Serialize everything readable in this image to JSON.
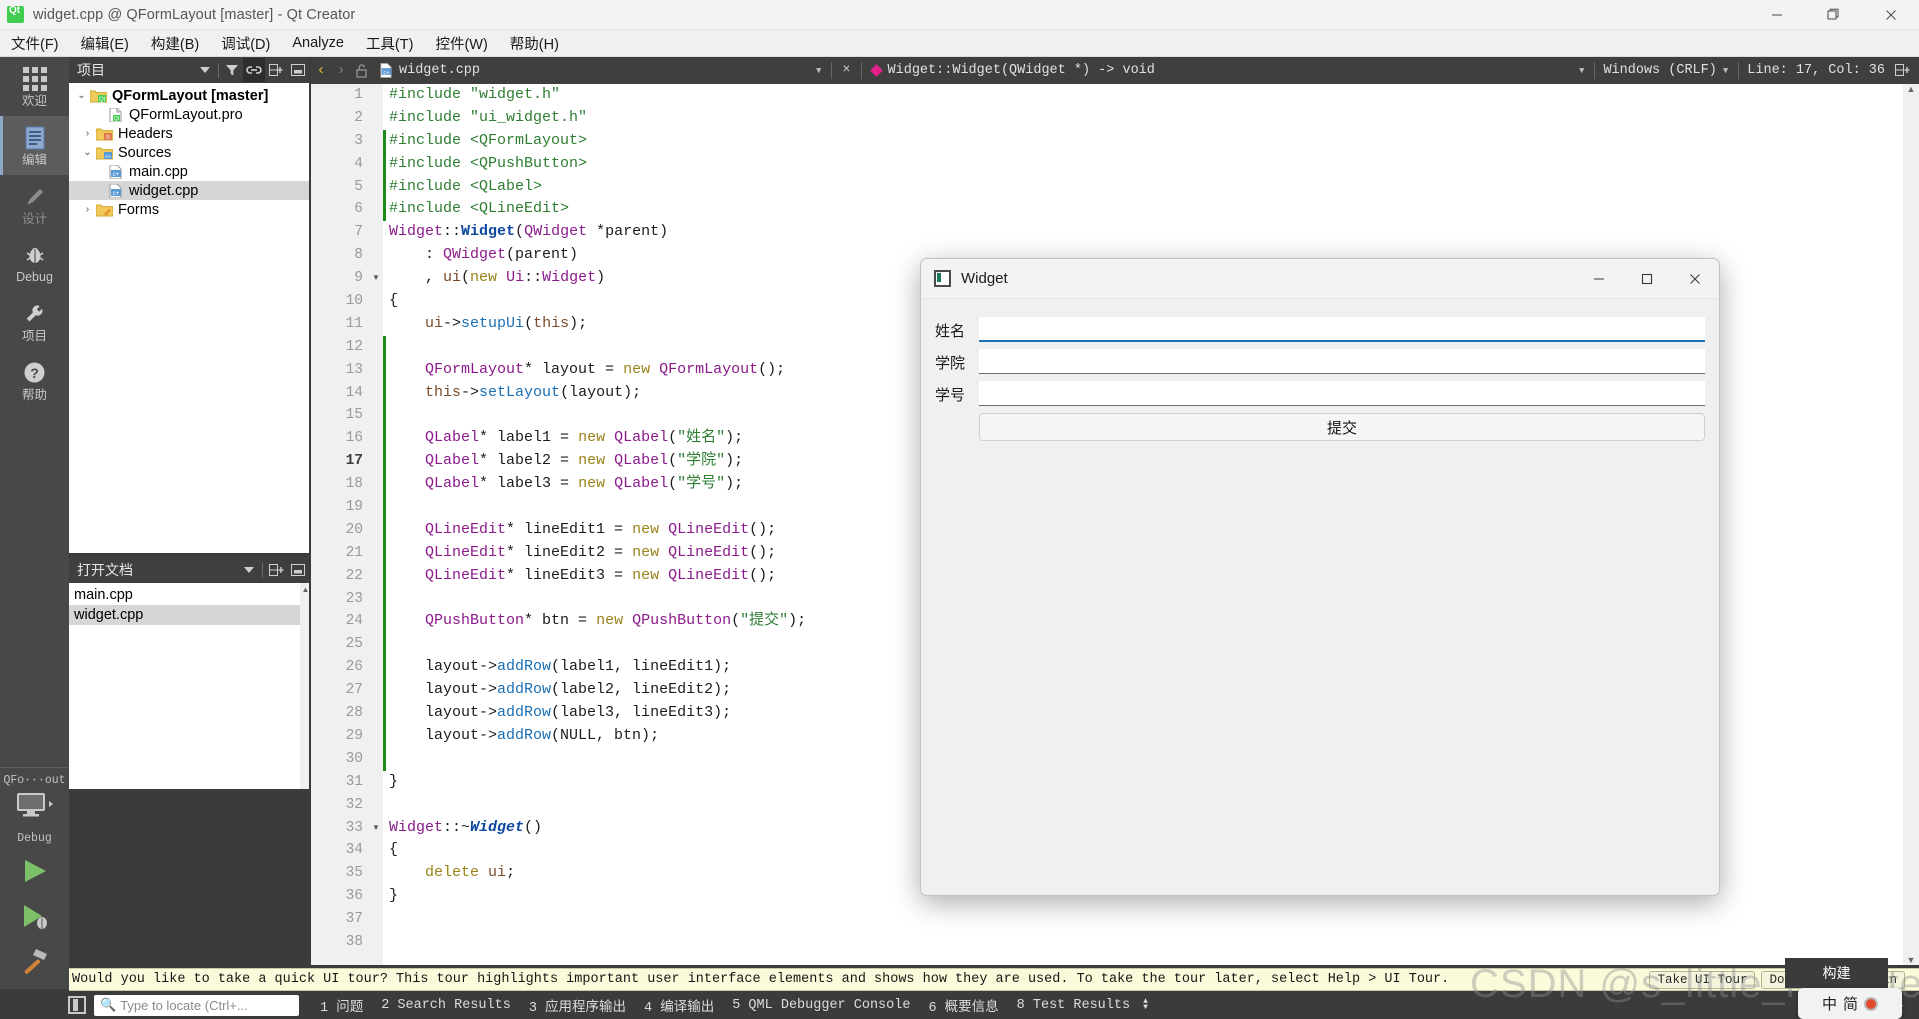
{
  "window": {
    "title": "widget.cpp @ QFormLayout [master] - Qt Creator",
    "minimize": "—",
    "maximize": "❐",
    "close": "✕"
  },
  "menubar": [
    {
      "label": "文件(F)"
    },
    {
      "label": "编辑(E)"
    },
    {
      "label": "构建(B)"
    },
    {
      "label": "调试(D)"
    },
    {
      "label": "Analyze"
    },
    {
      "label": "工具(T)"
    },
    {
      "label": "控件(W)"
    },
    {
      "label": "帮助(H)"
    }
  ],
  "modebar": {
    "items": [
      {
        "label": "欢迎",
        "icon": "grid-icon",
        "active": false
      },
      {
        "label": "编辑",
        "icon": "document-icon",
        "active": true
      },
      {
        "label": "设计",
        "icon": "pencil-icon",
        "active": false,
        "dim": true
      },
      {
        "label": "Debug",
        "icon": "bug-icon",
        "active": false
      },
      {
        "label": "项目",
        "icon": "wrench-icon",
        "active": false
      },
      {
        "label": "帮助",
        "icon": "question-icon",
        "active": false
      }
    ],
    "kit": {
      "project": "QFo···out",
      "build_config": "Debug",
      "run_label": "run-button",
      "debug_label": "start-debugging-button",
      "build_label": "build-button"
    }
  },
  "projects_panel": {
    "title": "项目",
    "tree": [
      {
        "label": "QFormLayout [master]",
        "depth": 0,
        "twisty": "⌄",
        "icon": "qt-project-icon",
        "bold": true,
        "selected": false
      },
      {
        "label": "QFormLayout.pro",
        "depth": 1,
        "twisty": "",
        "icon": "pro-file-icon",
        "bold": false,
        "selected": false
      },
      {
        "label": "Headers",
        "depth": 1,
        "twisty": "›",
        "icon": "headers-folder-icon",
        "bold": false,
        "selected": false
      },
      {
        "label": "Sources",
        "depth": 1,
        "twisty": "⌄",
        "icon": "sources-folder-icon",
        "bold": false,
        "selected": false
      },
      {
        "label": "main.cpp",
        "depth": 2,
        "twisty": "",
        "icon": "cpp-file-icon",
        "bold": false,
        "selected": false
      },
      {
        "label": "widget.cpp",
        "depth": 2,
        "twisty": "",
        "icon": "cpp-file-icon",
        "bold": false,
        "selected": true
      },
      {
        "label": "Forms",
        "depth": 1,
        "twisty": "›",
        "icon": "forms-folder-icon",
        "bold": false,
        "selected": false
      }
    ]
  },
  "documents_panel": {
    "title": "打开文档",
    "items": [
      {
        "label": "main.cpp",
        "selected": false
      },
      {
        "label": "widget.cpp",
        "selected": true
      }
    ]
  },
  "editor_toolbar": {
    "back": "‹",
    "forward": "›",
    "lock_icon": "unlocked-icon",
    "filename": "widget.cpp",
    "close_label": "×",
    "symbol": "Widget::Widget(QWidget *) -> void",
    "encoding": "Windows (CRLF)",
    "cursor_position": "Line: 17, Col: 36",
    "split_icon": "split-editor-icon"
  },
  "editor": {
    "current_line": 17,
    "total_lines": 38,
    "fold_lines": [
      9,
      33
    ],
    "lines": [
      {
        "n": 1,
        "tokens": [
          {
            "t": "#include ",
            "c": "k-pre"
          },
          {
            "t": "\"widget.h\"",
            "c": "k-str"
          }
        ]
      },
      {
        "n": 2,
        "tokens": [
          {
            "t": "#include ",
            "c": "k-pre"
          },
          {
            "t": "\"ui_widget.h\"",
            "c": "k-str"
          }
        ]
      },
      {
        "n": 3,
        "tokens": [
          {
            "t": "#include ",
            "c": "k-pre"
          },
          {
            "t": "<QFormLayout>",
            "c": "k-str"
          }
        ]
      },
      {
        "n": 4,
        "tokens": [
          {
            "t": "#include ",
            "c": "k-pre"
          },
          {
            "t": "<QPushButton>",
            "c": "k-str"
          }
        ]
      },
      {
        "n": 5,
        "tokens": [
          {
            "t": "#include ",
            "c": "k-pre"
          },
          {
            "t": "<QLabel>",
            "c": "k-str"
          }
        ]
      },
      {
        "n": 6,
        "tokens": [
          {
            "t": "#include ",
            "c": "k-pre"
          },
          {
            "t": "<QLineEdit>",
            "c": "k-str"
          }
        ]
      },
      {
        "n": 7,
        "tokens": [
          {
            "t": "Widget",
            "c": "k-type"
          },
          {
            "t": "::",
            "c": "k-plain"
          },
          {
            "t": "Widget",
            "c": "k-fnb"
          },
          {
            "t": "(",
            "c": "k-plain"
          },
          {
            "t": "QWidget",
            "c": "k-type"
          },
          {
            "t": " *parent)",
            "c": "k-plain"
          }
        ]
      },
      {
        "n": 8,
        "tokens": [
          {
            "t": "    : ",
            "c": "k-plain"
          },
          {
            "t": "QWidget",
            "c": "k-type"
          },
          {
            "t": "(parent)",
            "c": "k-plain"
          }
        ]
      },
      {
        "n": 9,
        "tokens": [
          {
            "t": "    , ",
            "c": "k-plain"
          },
          {
            "t": "ui",
            "c": "k-var"
          },
          {
            "t": "(",
            "c": "k-plain"
          },
          {
            "t": "new",
            "c": "k-kw"
          },
          {
            "t": " ",
            "c": "k-plain"
          },
          {
            "t": "Ui",
            "c": "k-type"
          },
          {
            "t": "::",
            "c": "k-plain"
          },
          {
            "t": "Widget",
            "c": "k-type"
          },
          {
            "t": ")",
            "c": "k-plain"
          }
        ]
      },
      {
        "n": 10,
        "tokens": [
          {
            "t": "{",
            "c": "k-plain"
          }
        ]
      },
      {
        "n": 11,
        "tokens": [
          {
            "t": "    ",
            "c": "k-plain"
          },
          {
            "t": "ui",
            "c": "k-var"
          },
          {
            "t": "->",
            "c": "k-plain"
          },
          {
            "t": "setupUi",
            "c": "k-fn"
          },
          {
            "t": "(",
            "c": "k-plain"
          },
          {
            "t": "this",
            "c": "k-var"
          },
          {
            "t": ");",
            "c": "k-plain"
          }
        ]
      },
      {
        "n": 12,
        "tokens": []
      },
      {
        "n": 13,
        "tokens": [
          {
            "t": "    ",
            "c": "k-plain"
          },
          {
            "t": "QFormLayout",
            "c": "k-type"
          },
          {
            "t": "* layout = ",
            "c": "k-plain"
          },
          {
            "t": "new",
            "c": "k-kw"
          },
          {
            "t": " ",
            "c": "k-plain"
          },
          {
            "t": "QFormLayout",
            "c": "k-type"
          },
          {
            "t": "();",
            "c": "k-plain"
          }
        ]
      },
      {
        "n": 14,
        "tokens": [
          {
            "t": "    ",
            "c": "k-plain"
          },
          {
            "t": "this",
            "c": "k-var"
          },
          {
            "t": "->",
            "c": "k-plain"
          },
          {
            "t": "setLayout",
            "c": "k-fn"
          },
          {
            "t": "(layout);",
            "c": "k-plain"
          }
        ]
      },
      {
        "n": 15,
        "tokens": []
      },
      {
        "n": 16,
        "tokens": [
          {
            "t": "    ",
            "c": "k-plain"
          },
          {
            "t": "QLabel",
            "c": "k-type"
          },
          {
            "t": "* label1 = ",
            "c": "k-plain"
          },
          {
            "t": "new",
            "c": "k-kw"
          },
          {
            "t": " ",
            "c": "k-plain"
          },
          {
            "t": "QLabel",
            "c": "k-type"
          },
          {
            "t": "(",
            "c": "k-plain"
          },
          {
            "t": "\"姓名\"",
            "c": "k-str"
          },
          {
            "t": ");",
            "c": "k-plain"
          }
        ]
      },
      {
        "n": 17,
        "tokens": [
          {
            "t": "    ",
            "c": "k-plain"
          },
          {
            "t": "QLabel",
            "c": "k-type"
          },
          {
            "t": "* label2 = ",
            "c": "k-plain"
          },
          {
            "t": "new",
            "c": "k-kw"
          },
          {
            "t": " ",
            "c": "k-plain"
          },
          {
            "t": "QLabel",
            "c": "k-type"
          },
          {
            "t": "(",
            "c": "k-plain"
          },
          {
            "t": "\"学院\"",
            "c": "k-str"
          },
          {
            "t": ");",
            "c": "k-plain"
          }
        ]
      },
      {
        "n": 18,
        "tokens": [
          {
            "t": "    ",
            "c": "k-plain"
          },
          {
            "t": "QLabel",
            "c": "k-type"
          },
          {
            "t": "* label3 = ",
            "c": "k-plain"
          },
          {
            "t": "new",
            "c": "k-kw"
          },
          {
            "t": " ",
            "c": "k-plain"
          },
          {
            "t": "QLabel",
            "c": "k-type"
          },
          {
            "t": "(",
            "c": "k-plain"
          },
          {
            "t": "\"学号\"",
            "c": "k-str"
          },
          {
            "t": ");",
            "c": "k-plain"
          }
        ]
      },
      {
        "n": 19,
        "tokens": []
      },
      {
        "n": 20,
        "tokens": [
          {
            "t": "    ",
            "c": "k-plain"
          },
          {
            "t": "QLineEdit",
            "c": "k-type"
          },
          {
            "t": "* lineEdit1 = ",
            "c": "k-plain"
          },
          {
            "t": "new",
            "c": "k-kw"
          },
          {
            "t": " ",
            "c": "k-plain"
          },
          {
            "t": "QLineEdit",
            "c": "k-type"
          },
          {
            "t": "();",
            "c": "k-plain"
          }
        ]
      },
      {
        "n": 21,
        "tokens": [
          {
            "t": "    ",
            "c": "k-plain"
          },
          {
            "t": "QLineEdit",
            "c": "k-type"
          },
          {
            "t": "* lineEdit2 = ",
            "c": "k-plain"
          },
          {
            "t": "new",
            "c": "k-kw"
          },
          {
            "t": " ",
            "c": "k-plain"
          },
          {
            "t": "QLineEdit",
            "c": "k-type"
          },
          {
            "t": "();",
            "c": "k-plain"
          }
        ]
      },
      {
        "n": 22,
        "tokens": [
          {
            "t": "    ",
            "c": "k-plain"
          },
          {
            "t": "QLineEdit",
            "c": "k-type"
          },
          {
            "t": "* lineEdit3 = ",
            "c": "k-plain"
          },
          {
            "t": "new",
            "c": "k-kw"
          },
          {
            "t": " ",
            "c": "k-plain"
          },
          {
            "t": "QLineEdit",
            "c": "k-type"
          },
          {
            "t": "();",
            "c": "k-plain"
          }
        ]
      },
      {
        "n": 23,
        "tokens": []
      },
      {
        "n": 24,
        "tokens": [
          {
            "t": "    ",
            "c": "k-plain"
          },
          {
            "t": "QPushButton",
            "c": "k-type"
          },
          {
            "t": "* btn = ",
            "c": "k-plain"
          },
          {
            "t": "new",
            "c": "k-kw"
          },
          {
            "t": " ",
            "c": "k-plain"
          },
          {
            "t": "QPushButton",
            "c": "k-type"
          },
          {
            "t": "(",
            "c": "k-plain"
          },
          {
            "t": "\"提交\"",
            "c": "k-str"
          },
          {
            "t": ");",
            "c": "k-plain"
          }
        ]
      },
      {
        "n": 25,
        "tokens": []
      },
      {
        "n": 26,
        "tokens": [
          {
            "t": "    layout->",
            "c": "k-plain"
          },
          {
            "t": "addRow",
            "c": "k-fn"
          },
          {
            "t": "(label1, lineEdit1);",
            "c": "k-plain"
          }
        ]
      },
      {
        "n": 27,
        "tokens": [
          {
            "t": "    layout->",
            "c": "k-plain"
          },
          {
            "t": "addRow",
            "c": "k-fn"
          },
          {
            "t": "(label2, lineEdit2);",
            "c": "k-plain"
          }
        ]
      },
      {
        "n": 28,
        "tokens": [
          {
            "t": "    layout->",
            "c": "k-plain"
          },
          {
            "t": "addRow",
            "c": "k-fn"
          },
          {
            "t": "(label3, lineEdit3);",
            "c": "k-plain"
          }
        ]
      },
      {
        "n": 29,
        "tokens": [
          {
            "t": "    layout->",
            "c": "k-plain"
          },
          {
            "t": "addRow",
            "c": "k-fn"
          },
          {
            "t": "(NULL, btn);",
            "c": "k-plain"
          }
        ]
      },
      {
        "n": 30,
        "tokens": []
      },
      {
        "n": 31,
        "tokens": [
          {
            "t": "}",
            "c": "k-plain"
          }
        ]
      },
      {
        "n": 32,
        "tokens": []
      },
      {
        "n": 33,
        "tokens": [
          {
            "t": "Widget",
            "c": "k-type"
          },
          {
            "t": "::~",
            "c": "k-plain"
          },
          {
            "t": "Widget",
            "c": "k-fni"
          },
          {
            "t": "()",
            "c": "k-plain"
          }
        ]
      },
      {
        "n": 34,
        "tokens": [
          {
            "t": "{",
            "c": "k-plain"
          }
        ]
      },
      {
        "n": 35,
        "tokens": [
          {
            "t": "    ",
            "c": "k-plain"
          },
          {
            "t": "delete",
            "c": "k-kw"
          },
          {
            "t": " ",
            "c": "k-plain"
          },
          {
            "t": "ui",
            "c": "k-var"
          },
          {
            "t": ";",
            "c": "k-plain"
          }
        ]
      },
      {
        "n": 36,
        "tokens": [
          {
            "t": "}",
            "c": "k-plain"
          }
        ]
      },
      {
        "n": 37,
        "tokens": []
      },
      {
        "n": 38,
        "tokens": []
      }
    ]
  },
  "dialog": {
    "title": "Widget",
    "minimize": "—",
    "maximize": "❐",
    "close": "✕",
    "fields": [
      {
        "label": "姓名",
        "value": "",
        "focused": true
      },
      {
        "label": "学院",
        "value": "",
        "focused": false
      },
      {
        "label": "学号",
        "value": "",
        "focused": false
      }
    ],
    "submit_label": "提交"
  },
  "tour": {
    "message": "Would you like to take a quick UI tour? This tour highlights important user interface elements and shows how they are used. To take the tour later, select Help > UI Tour.",
    "take_label": "Take UI Tour",
    "dismiss_label": "Do Not Show Again"
  },
  "statusbar": {
    "locator_placeholder": "Type to locate (Ctrl+...",
    "items": [
      {
        "label": "1 问题"
      },
      {
        "label": "2 Search Results"
      },
      {
        "label": "3 应用程序输出"
      },
      {
        "label": "4 编译输出"
      },
      {
        "label": "5 QML Debugger Console"
      },
      {
        "label": "6 概要信息"
      },
      {
        "label": "8 Test Results"
      }
    ]
  },
  "overlays": {
    "build_tooltip": "构建",
    "ime_mode": "中",
    "ime_shape": "简",
    "watermark": "CSDN @s_little_monster"
  },
  "colors": {
    "accent": "#41cd52",
    "selection": "#d6d6d6",
    "panel_header": "#3f3f3f",
    "mode_bar": "#484848",
    "focus_underline": "#1b6fb5",
    "tour_bg": "#fbfbdc"
  }
}
